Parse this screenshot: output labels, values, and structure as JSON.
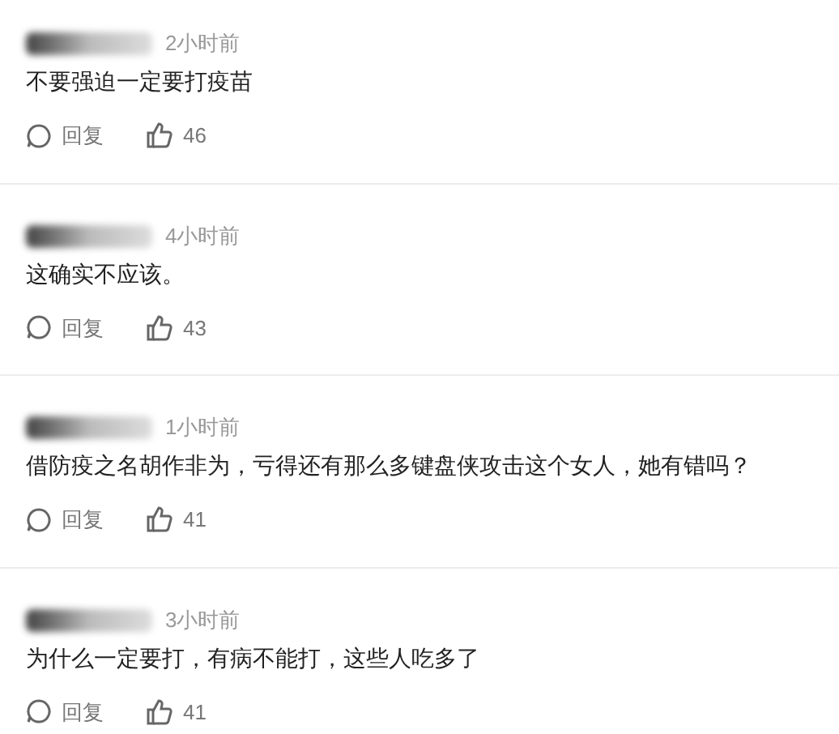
{
  "comments": [
    {
      "time": "2小时前",
      "text": "不要强迫一定要打疫苗",
      "reply": "回复",
      "likes": "46"
    },
    {
      "time": "4小时前",
      "text": "这确实不应该。",
      "reply": "回复",
      "likes": "43"
    },
    {
      "time": "1小时前",
      "text": "借防疫之名胡作非为，亏得还有那么多键盘侠攻击这个女人，她有错吗？",
      "reply": "回复",
      "likes": "41"
    },
    {
      "time": "3小时前",
      "text": "为什么一定要打，有病不能打，这些人吃多了",
      "reply": "回复",
      "likes": "41"
    }
  ]
}
